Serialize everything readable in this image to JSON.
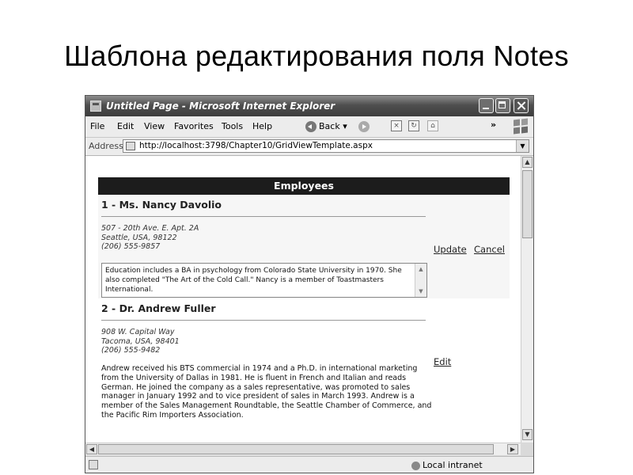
{
  "slide": {
    "title": "Шаблона редактирования поля Notes"
  },
  "window": {
    "title": "Untitled Page - Microsoft Internet Explorer"
  },
  "menu": {
    "items": [
      "File",
      "Edit",
      "View",
      "Favorites",
      "Tools",
      "Help"
    ],
    "back_label": "Back"
  },
  "address": {
    "label": "Address",
    "url": "http://localhost:3798/Chapter10/GridViewTemplate.aspx"
  },
  "grid": {
    "header": "Employees",
    "rows": [
      {
        "name": "1 - Ms. Nancy Davolio",
        "address_line1": "507 - 20th Ave. E. Apt. 2A",
        "address_line2": "Seattle, USA, 98122",
        "phone": "(206) 555-9857",
        "notes": "Education includes a BA in psychology from Colorado State University in 1970.  She also completed \"The Art of the Cold Call.\"  Nancy is a member of Toastmasters International.",
        "actions": [
          "Update",
          "Cancel"
        ]
      },
      {
        "name": "2 - Dr. Andrew Fuller",
        "address_line1": "908 W. Capital Way",
        "address_line2": "Tacoma, USA, 98401",
        "phone": "(206) 555-9482",
        "notes": "Andrew received his BTS commercial in 1974 and a Ph.D. in international marketing from the University of Dallas in 1981. He is fluent in French and Italian and reads German. He joined the company as a sales representative, was promoted to sales manager in January 1992 and to vice president of sales in March 1993. Andrew is a member of the Sales Management Roundtable, the Seattle Chamber of Commerce, and the Pacific Rim Importers Association.",
        "actions": [
          "Edit"
        ]
      }
    ]
  },
  "status": {
    "zone": "Local intranet"
  }
}
